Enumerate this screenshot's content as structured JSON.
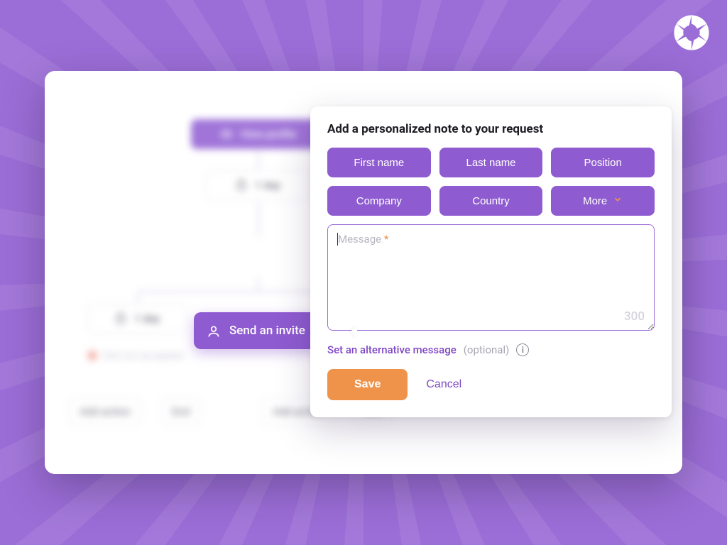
{
  "brand": {
    "name": "aperture-logo"
  },
  "workflow": {
    "view_profile": "View profile",
    "delay_1": "1 day",
    "send_invite": "Send an invite",
    "delay_2": "1 day",
    "status_not_accepted": "Did not accepted",
    "add_action": "Add action",
    "end": "End"
  },
  "panel": {
    "title": "Add a personalized note to your request",
    "chips": {
      "first_name": "First name",
      "last_name": "Last name",
      "position": "Position",
      "company": "Company",
      "country": "Country",
      "more": "More"
    },
    "message": {
      "placeholder_text": "Message",
      "required_mark": "*",
      "value": "",
      "char_limit": "300"
    },
    "alt_link": "Set an alternative message",
    "alt_optional": "(optional)",
    "save": "Save",
    "cancel": "Cancel"
  },
  "colors": {
    "accent_purple": "#8e5bd0",
    "accent_orange": "#f0934a",
    "bg_purple": "#9b6dd7"
  }
}
